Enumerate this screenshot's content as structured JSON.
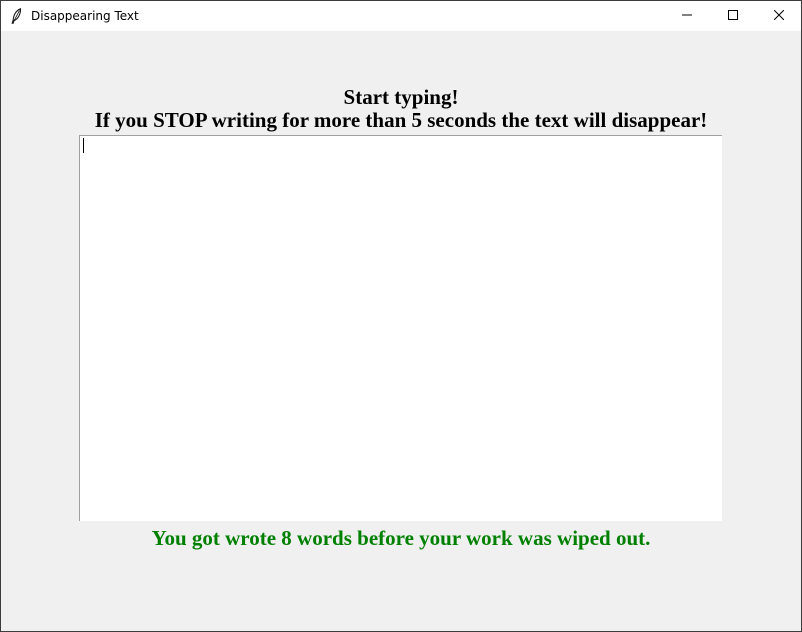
{
  "window": {
    "title": "Disappearing Text",
    "app_icon": "feather-icon",
    "controls": {
      "minimize_icon": "minimize-icon",
      "maximize_icon": "maximize-icon",
      "close_icon": "close-icon"
    }
  },
  "main": {
    "heading_line1": "Start typing!",
    "heading_line2": "If you STOP writing for more than 5 seconds the text will disappear!",
    "text_area_value": "",
    "status_message": "You got wrote 8 words before your work was wiped out.",
    "status_color": "#008000"
  }
}
